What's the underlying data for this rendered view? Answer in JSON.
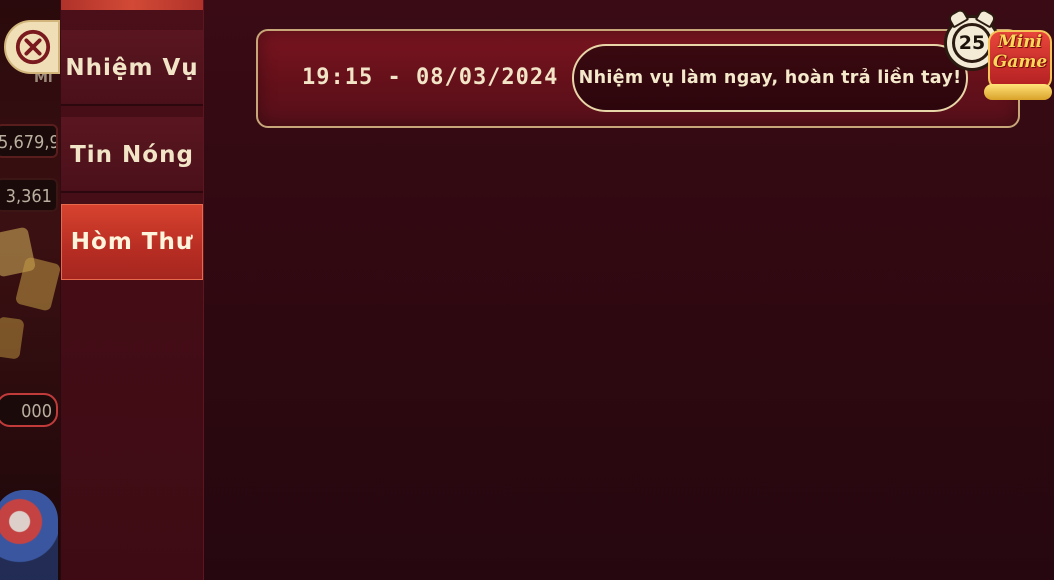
{
  "background": {
    "values": [
      "5,679,9",
      "3,361",
      "000"
    ],
    "mini_label": "Mi"
  },
  "sidebar": {
    "items": [
      {
        "label": "Nhiệm Vụ",
        "active": false
      },
      {
        "label": "Tin Nóng",
        "active": false
      },
      {
        "label": "Hòm Thư",
        "active": true
      }
    ]
  },
  "notification": {
    "time": "19:15 - 08/03/2024",
    "message": "Nhiệm vụ làm ngay, hoàn trả liền tay!"
  },
  "timer": {
    "value": "25"
  },
  "minigame": {
    "line1": "Mini",
    "line2": "Game"
  },
  "colors": {
    "panel": "#2d0810",
    "active_tab": "#c9362a",
    "text": "#f2e4c6",
    "card_border": "#c7a779"
  },
  "icons": {
    "close": "close-circle-icon",
    "timer": "alarm-clock-icon",
    "minigame": "minigame-badge-icon"
  }
}
